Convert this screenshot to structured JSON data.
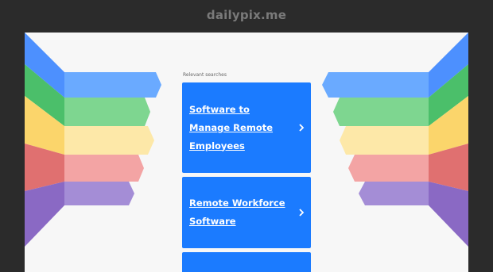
{
  "header": {
    "domain": "dailypix.me"
  },
  "main": {
    "relevant_label": "Relevant searches",
    "results": [
      {
        "label": "Software to Manage Remote Employees"
      },
      {
        "label": "Remote Workforce Software"
      },
      {
        "label": ""
      }
    ]
  },
  "icons": {
    "result_arrow": "chevron-right-icon"
  },
  "colors": {
    "background": "#2b2b2b",
    "page": "#f7f7f7",
    "accent": "#1b7bff",
    "stripe_blue": "#5aa2ff",
    "stripe_green": "#6ed184",
    "stripe_yellow": "#fce39a",
    "stripe_red": "#e88a8a",
    "stripe_purple": "#9a7ccf"
  }
}
